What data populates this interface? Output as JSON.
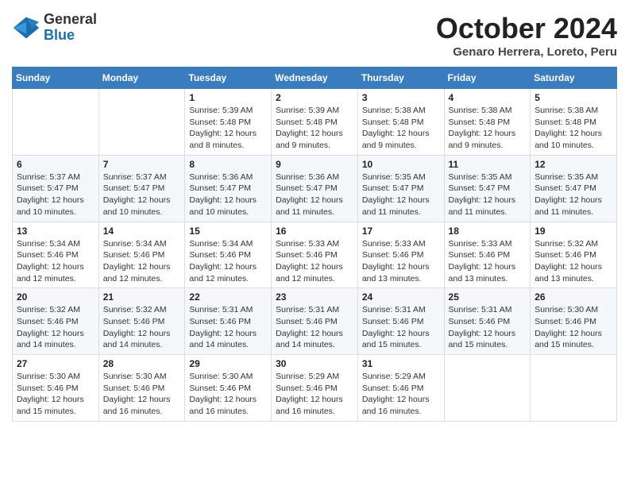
{
  "header": {
    "logo": {
      "general": "General",
      "blue": "Blue"
    },
    "title": "October 2024",
    "location": "Genaro Herrera, Loreto, Peru"
  },
  "calendar": {
    "days_of_week": [
      "Sunday",
      "Monday",
      "Tuesday",
      "Wednesday",
      "Thursday",
      "Friday",
      "Saturday"
    ],
    "weeks": [
      [
        {
          "day": "",
          "info": ""
        },
        {
          "day": "",
          "info": ""
        },
        {
          "day": "1",
          "sunrise": "5:39 AM",
          "sunset": "5:48 PM",
          "daylight": "12 hours and 8 minutes."
        },
        {
          "day": "2",
          "sunrise": "5:39 AM",
          "sunset": "5:48 PM",
          "daylight": "12 hours and 9 minutes."
        },
        {
          "day": "3",
          "sunrise": "5:38 AM",
          "sunset": "5:48 PM",
          "daylight": "12 hours and 9 minutes."
        },
        {
          "day": "4",
          "sunrise": "5:38 AM",
          "sunset": "5:48 PM",
          "daylight": "12 hours and 9 minutes."
        },
        {
          "day": "5",
          "sunrise": "5:38 AM",
          "sunset": "5:48 PM",
          "daylight": "12 hours and 10 minutes."
        }
      ],
      [
        {
          "day": "6",
          "sunrise": "5:37 AM",
          "sunset": "5:47 PM",
          "daylight": "12 hours and 10 minutes."
        },
        {
          "day": "7",
          "sunrise": "5:37 AM",
          "sunset": "5:47 PM",
          "daylight": "12 hours and 10 minutes."
        },
        {
          "day": "8",
          "sunrise": "5:36 AM",
          "sunset": "5:47 PM",
          "daylight": "12 hours and 10 minutes."
        },
        {
          "day": "9",
          "sunrise": "5:36 AM",
          "sunset": "5:47 PM",
          "daylight": "12 hours and 11 minutes."
        },
        {
          "day": "10",
          "sunrise": "5:35 AM",
          "sunset": "5:47 PM",
          "daylight": "12 hours and 11 minutes."
        },
        {
          "day": "11",
          "sunrise": "5:35 AM",
          "sunset": "5:47 PM",
          "daylight": "12 hours and 11 minutes."
        },
        {
          "day": "12",
          "sunrise": "5:35 AM",
          "sunset": "5:47 PM",
          "daylight": "12 hours and 11 minutes."
        }
      ],
      [
        {
          "day": "13",
          "sunrise": "5:34 AM",
          "sunset": "5:46 PM",
          "daylight": "12 hours and 12 minutes."
        },
        {
          "day": "14",
          "sunrise": "5:34 AM",
          "sunset": "5:46 PM",
          "daylight": "12 hours and 12 minutes."
        },
        {
          "day": "15",
          "sunrise": "5:34 AM",
          "sunset": "5:46 PM",
          "daylight": "12 hours and 12 minutes."
        },
        {
          "day": "16",
          "sunrise": "5:33 AM",
          "sunset": "5:46 PM",
          "daylight": "12 hours and 12 minutes."
        },
        {
          "day": "17",
          "sunrise": "5:33 AM",
          "sunset": "5:46 PM",
          "daylight": "12 hours and 13 minutes."
        },
        {
          "day": "18",
          "sunrise": "5:33 AM",
          "sunset": "5:46 PM",
          "daylight": "12 hours and 13 minutes."
        },
        {
          "day": "19",
          "sunrise": "5:32 AM",
          "sunset": "5:46 PM",
          "daylight": "12 hours and 13 minutes."
        }
      ],
      [
        {
          "day": "20",
          "sunrise": "5:32 AM",
          "sunset": "5:46 PM",
          "daylight": "12 hours and 14 minutes."
        },
        {
          "day": "21",
          "sunrise": "5:32 AM",
          "sunset": "5:46 PM",
          "daylight": "12 hours and 14 minutes."
        },
        {
          "day": "22",
          "sunrise": "5:31 AM",
          "sunset": "5:46 PM",
          "daylight": "12 hours and 14 minutes."
        },
        {
          "day": "23",
          "sunrise": "5:31 AM",
          "sunset": "5:46 PM",
          "daylight": "12 hours and 14 minutes."
        },
        {
          "day": "24",
          "sunrise": "5:31 AM",
          "sunset": "5:46 PM",
          "daylight": "12 hours and 15 minutes."
        },
        {
          "day": "25",
          "sunrise": "5:31 AM",
          "sunset": "5:46 PM",
          "daylight": "12 hours and 15 minutes."
        },
        {
          "day": "26",
          "sunrise": "5:30 AM",
          "sunset": "5:46 PM",
          "daylight": "12 hours and 15 minutes."
        }
      ],
      [
        {
          "day": "27",
          "sunrise": "5:30 AM",
          "sunset": "5:46 PM",
          "daylight": "12 hours and 15 minutes."
        },
        {
          "day": "28",
          "sunrise": "5:30 AM",
          "sunset": "5:46 PM",
          "daylight": "12 hours and 16 minutes."
        },
        {
          "day": "29",
          "sunrise": "5:30 AM",
          "sunset": "5:46 PM",
          "daylight": "12 hours and 16 minutes."
        },
        {
          "day": "30",
          "sunrise": "5:29 AM",
          "sunset": "5:46 PM",
          "daylight": "12 hours and 16 minutes."
        },
        {
          "day": "31",
          "sunrise": "5:29 AM",
          "sunset": "5:46 PM",
          "daylight": "12 hours and 16 minutes."
        },
        {
          "day": "",
          "info": ""
        },
        {
          "day": "",
          "info": ""
        }
      ]
    ],
    "sunrise_label": "Sunrise:",
    "sunset_label": "Sunset:",
    "daylight_label": "Daylight:"
  }
}
